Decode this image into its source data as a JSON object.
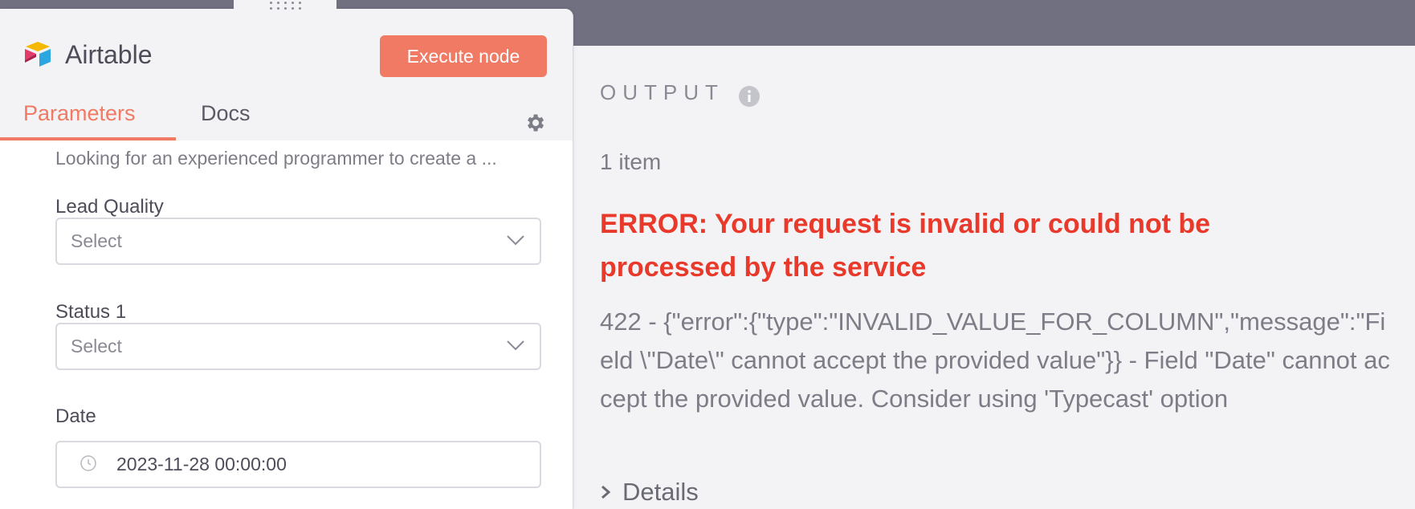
{
  "node": {
    "title": "Airtable",
    "execute_label": "Execute node",
    "tabs": [
      {
        "label": "Parameters",
        "active": true
      },
      {
        "label": "Docs",
        "active": false
      }
    ],
    "settings_icon": "gear-icon",
    "logo_icon": "airtable-logo-icon"
  },
  "params": {
    "description_preview": "Looking for an experienced programmer to create a ...",
    "fields": [
      {
        "label": "Lead Quality",
        "placeholder": "Select"
      },
      {
        "label": "Status 1",
        "placeholder": "Select"
      }
    ],
    "date": {
      "label": "Date",
      "value": "2023-11-28 00:00:00"
    }
  },
  "output": {
    "title": "OUTPUT",
    "info_icon": "info-icon",
    "item_count": "1 item",
    "error_title": "ERROR: Your request is invalid or could not be processed by the service",
    "error_message": "422 - {\"error\":{\"type\":\"INVALID_VALUE_FOR_COLUMN\",\"message\":\"Field \\\"Date\\\" cannot accept the provided value\"}} - Field \"Date\" cannot accept the provided value. Consider using 'Typecast' option",
    "details_label": "Details"
  },
  "colors": {
    "accent": "#f07a63",
    "error": "#e8392b",
    "backdrop": "#717080"
  }
}
